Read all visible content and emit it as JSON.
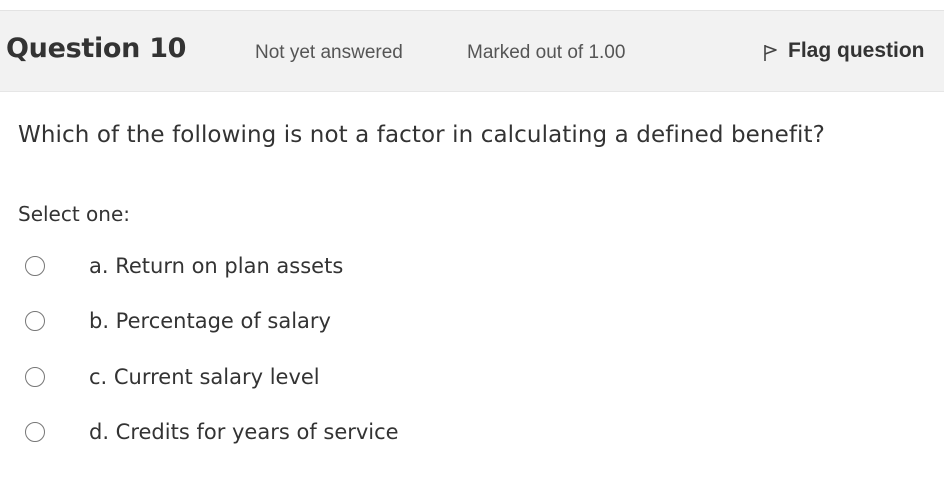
{
  "question": {
    "title": "Question 10",
    "status": "Not yet answered",
    "marks": "Marked out of 1.00",
    "flag_label": "Flag question",
    "text": "Which of the following is not a factor in calculating a defined benefit?",
    "select_prompt": "Select one:",
    "options": [
      {
        "label": "a. Return on plan assets",
        "selected": false
      },
      {
        "label": "b. Percentage of salary",
        "selected": false
      },
      {
        "label": "c. Current salary level",
        "selected": false
      },
      {
        "label": "d. Credits for years of service",
        "selected": false
      }
    ]
  },
  "icons": {
    "flag": "flag-icon",
    "radio": "radio-button"
  }
}
